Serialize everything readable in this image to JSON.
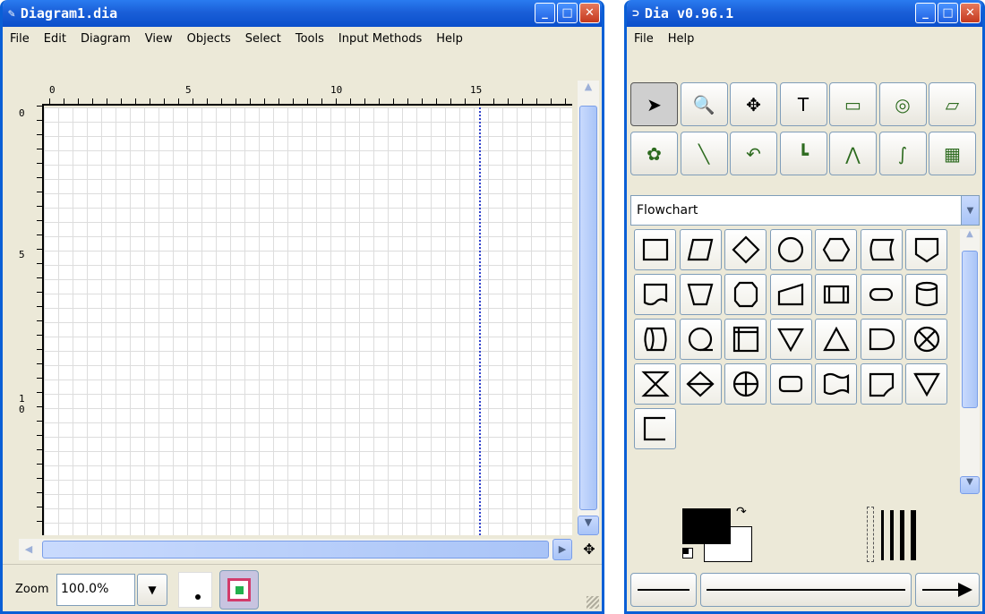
{
  "diagram_window": {
    "title": "Diagram1.dia",
    "title_icon": "dia-icon",
    "menu": [
      "File",
      "Edit",
      "Diagram",
      "View",
      "Objects",
      "Select",
      "Tools",
      "Input Methods",
      "Help"
    ],
    "ruler_h_labels": [
      "0",
      "5",
      "10",
      "15"
    ],
    "ruler_v_labels": [
      "0",
      "5",
      "1\n0"
    ],
    "zoom_label": "Zoom",
    "zoom_value": "100.0%"
  },
  "toolbox_window": {
    "title": "Dia v0.96.1",
    "title_icon": "dia-icon",
    "menu": [
      "File",
      "Help"
    ],
    "tools": [
      {
        "name": "pointer-tool",
        "glyph": "➤"
      },
      {
        "name": "magnify-tool",
        "glyph": "🔍"
      },
      {
        "name": "scroll-tool",
        "glyph": "✥"
      },
      {
        "name": "text-tool",
        "glyph": "T"
      },
      {
        "name": "box-tool",
        "glyph": "▭"
      },
      {
        "name": "ellipse-tool",
        "glyph": "◎"
      },
      {
        "name": "polygon-tool",
        "glyph": "▱"
      },
      {
        "name": "beziergon-tool",
        "glyph": "✿"
      },
      {
        "name": "line-tool",
        "glyph": "╲"
      },
      {
        "name": "arc-tool",
        "glyph": "↶"
      },
      {
        "name": "zigzag-line-tool",
        "glyph": "┗"
      },
      {
        "name": "polyline-tool",
        "glyph": "⋀"
      },
      {
        "name": "bezier-line-tool",
        "glyph": "∫"
      },
      {
        "name": "image-tool",
        "glyph": "▦"
      }
    ],
    "sheet_selected": "Flowchart",
    "shape_count": 29
  },
  "colors": {
    "titlebar": "#0a4fcb",
    "window_bg": "#ece9d8",
    "border": "#7f9db9",
    "grid": "#dddddd"
  }
}
